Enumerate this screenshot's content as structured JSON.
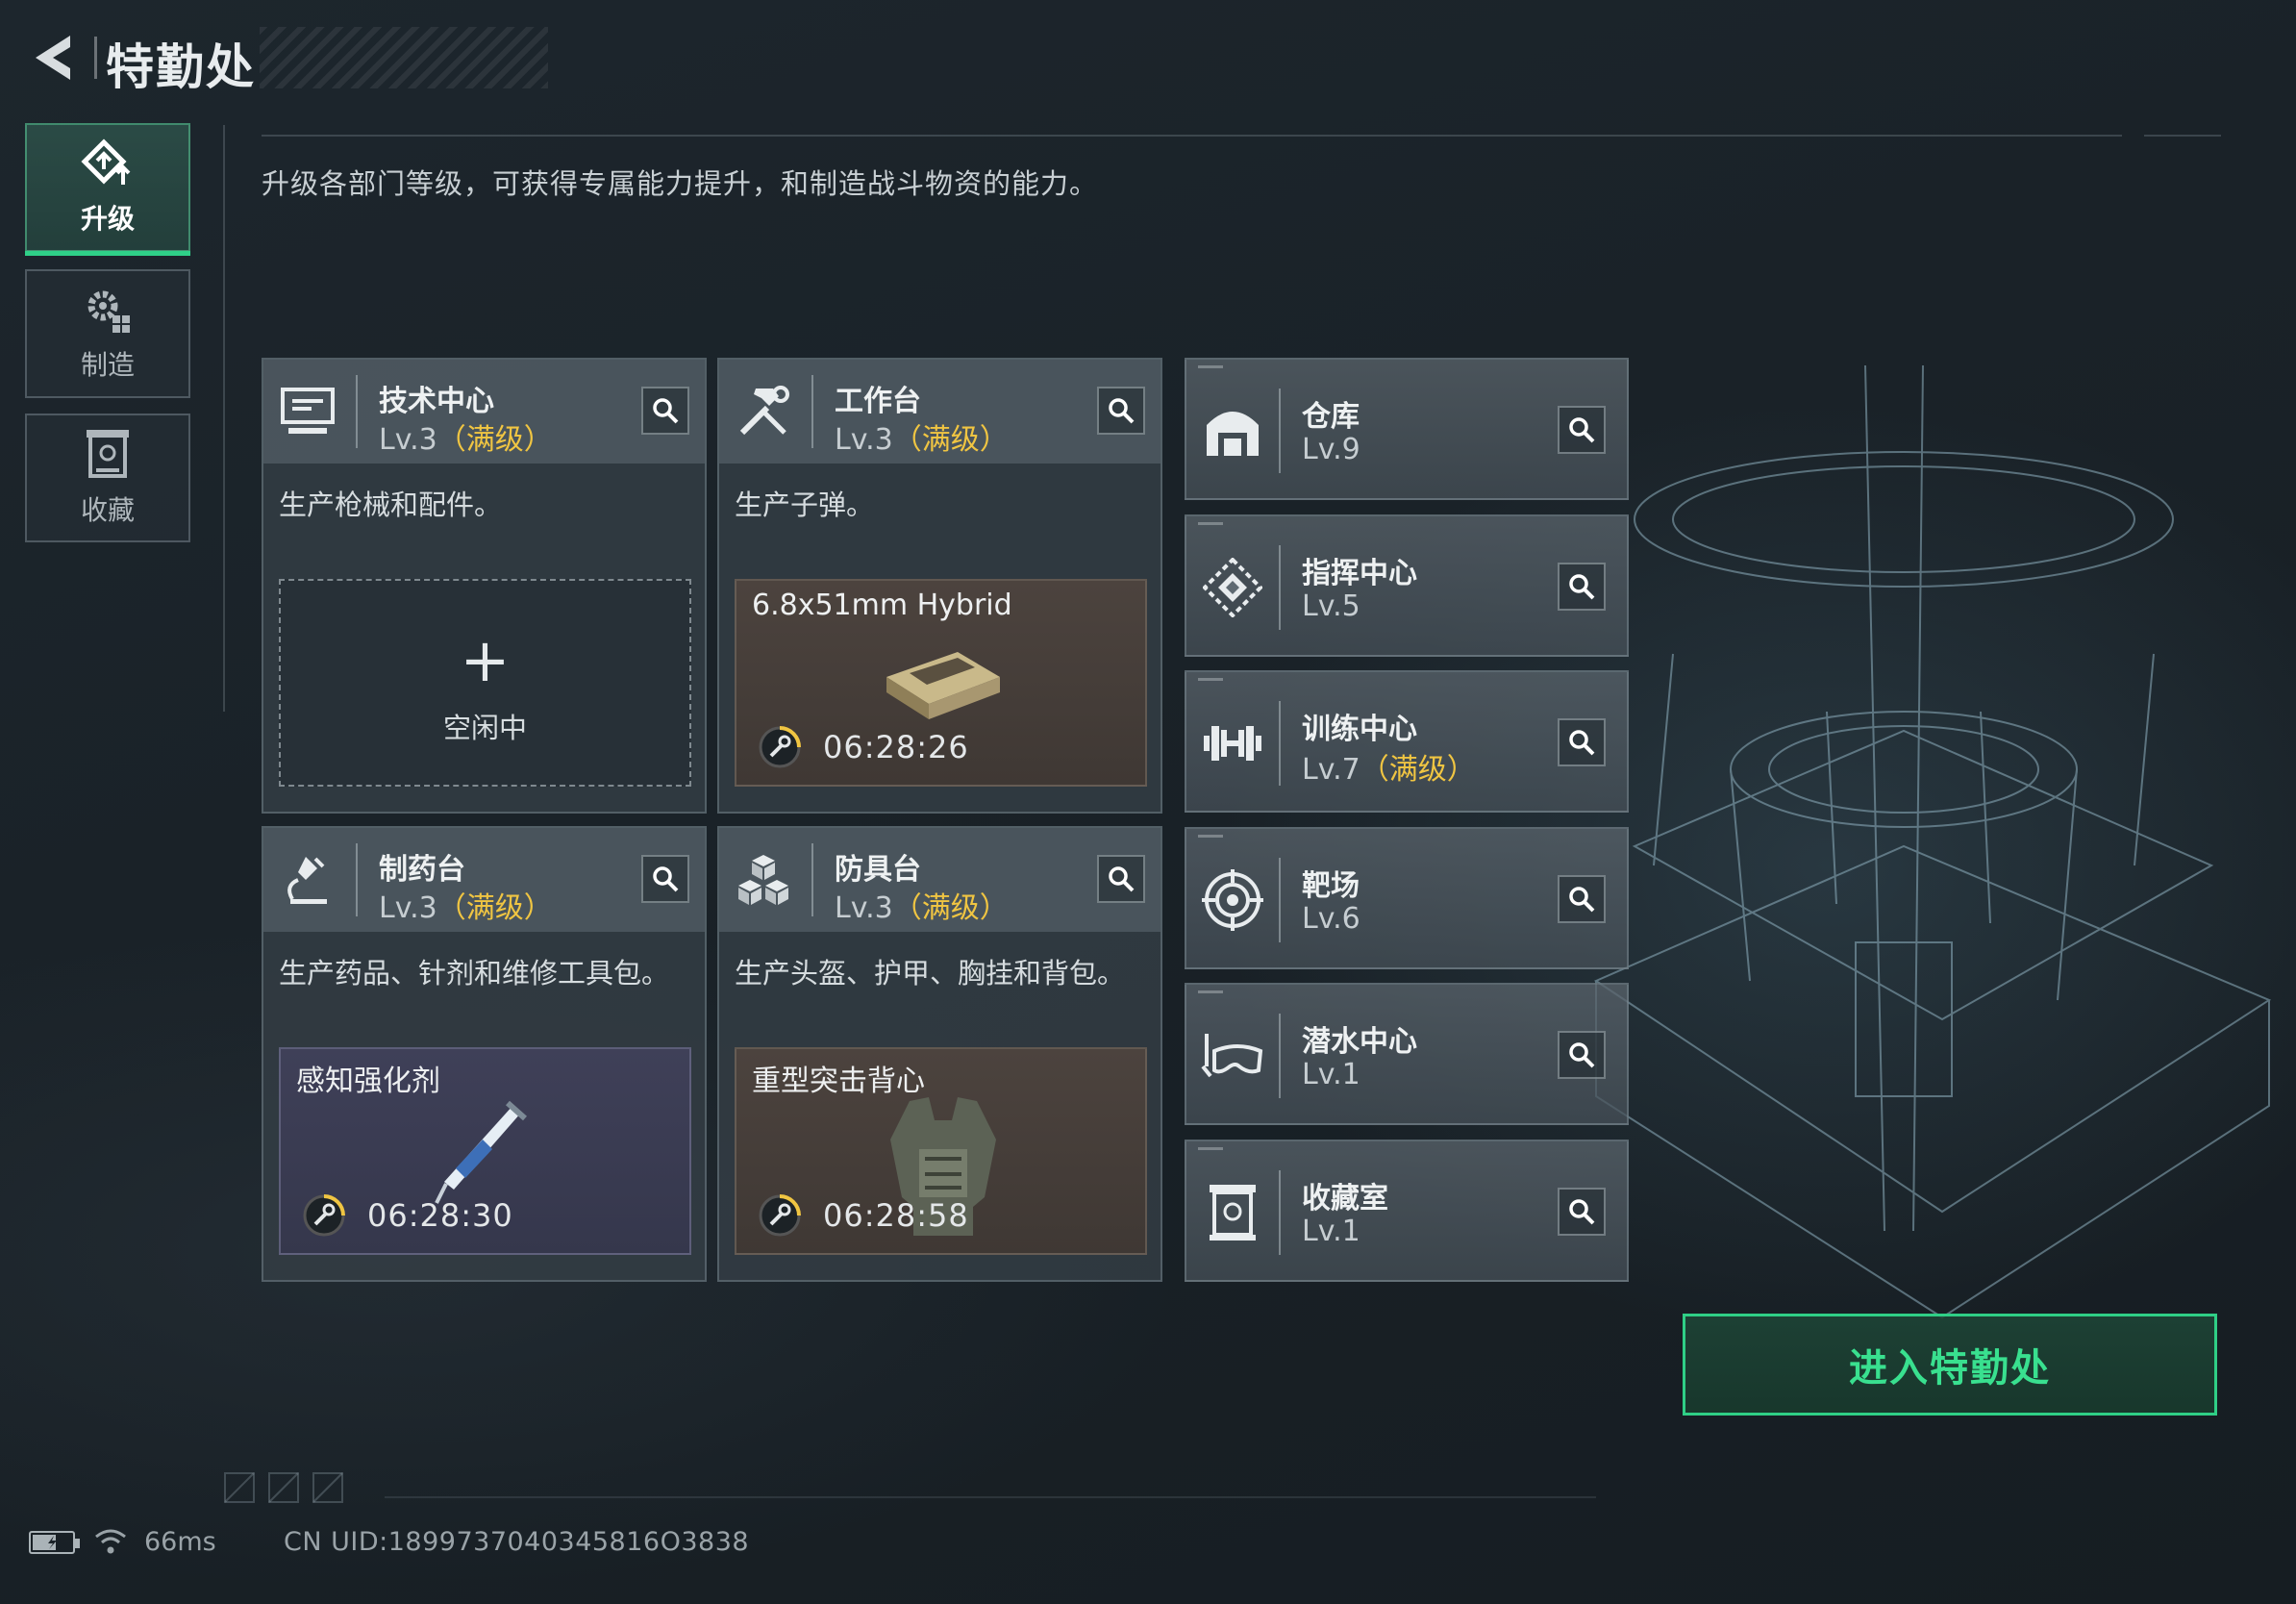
{
  "header": {
    "title": "特勤处"
  },
  "sidebar": {
    "tabs": [
      {
        "label": "升级",
        "icon": "upgrade-icon",
        "active": true
      },
      {
        "label": "制造",
        "icon": "gears-icon",
        "active": false
      },
      {
        "label": "收藏",
        "icon": "collection-icon",
        "active": false
      }
    ]
  },
  "description": "升级各部门等级，可获得专属能力提升，和制造战斗物资的能力。",
  "workstations": [
    {
      "name": "技术中心",
      "level": "Lv.3",
      "max_tag": "（满级）",
      "icon": "monitor-icon",
      "desc": "生产枪械和配件。",
      "slot": {
        "state": "idle",
        "idle_text": "空闲中",
        "plus": "+"
      }
    },
    {
      "name": "工作台",
      "level": "Lv.3",
      "max_tag": "（满级）",
      "icon": "hammer-wrench-icon",
      "desc": "生产子弹。",
      "slot": {
        "state": "crafting",
        "item": "6.8x51mm Hybrid",
        "timer": "06:28:26",
        "item_icon": "ammo-box-icon"
      }
    },
    {
      "name": "制药台",
      "level": "Lv.3",
      "max_tag": "（满级）",
      "icon": "microscope-icon",
      "desc": "生产药品、针剂和维修工具包。",
      "slot": {
        "state": "crafting",
        "item": "感知强化剂",
        "timer": "06:28:30",
        "item_icon": "syringe-icon"
      }
    },
    {
      "name": "防具台",
      "level": "Lv.3",
      "max_tag": "（满级）",
      "icon": "cubes-icon",
      "desc": "生产头盔、护甲、胸挂和背包。",
      "slot": {
        "state": "crafting",
        "item": "重型突击背心",
        "timer": "06:28:58",
        "item_icon": "vest-icon"
      }
    }
  ],
  "facilities": [
    {
      "name": "仓库",
      "level": "Lv.9",
      "max_tag": "",
      "icon": "warehouse-icon"
    },
    {
      "name": "指挥中心",
      "level": "Lv.5",
      "max_tag": "",
      "icon": "command-icon"
    },
    {
      "name": "训练中心",
      "level": "Lv.7",
      "max_tag": "（满级）",
      "icon": "dumbbell-icon"
    },
    {
      "name": "靶场",
      "level": "Lv.6",
      "max_tag": "",
      "icon": "target-icon"
    },
    {
      "name": "潜水中心",
      "level": "Lv.1",
      "max_tag": "",
      "icon": "diving-mask-icon"
    },
    {
      "name": "收藏室",
      "level": "Lv.1",
      "max_tag": "",
      "icon": "collection-room-icon"
    }
  ],
  "enter_button": "进入特勤处",
  "status": {
    "ping": "66ms",
    "uid": "CN UID:1899737040345816O3838"
  },
  "colors": {
    "accent": "#2fd088",
    "max_level": "#f0c542"
  }
}
